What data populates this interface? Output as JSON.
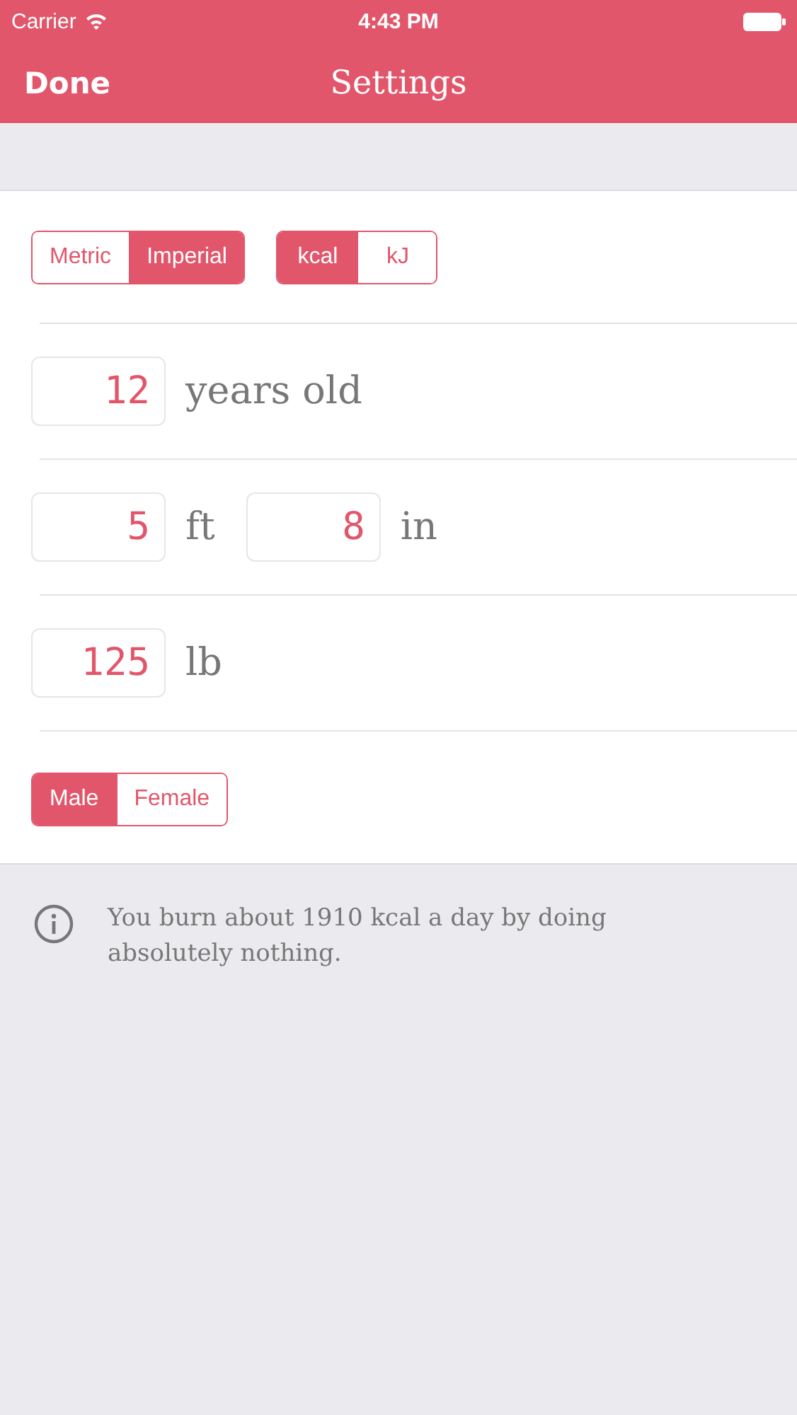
{
  "status_bar": {
    "carrier": "Carrier",
    "time": "4:43 PM"
  },
  "nav_bar": {
    "left_button": "Done",
    "title": "Settings"
  },
  "rows": [
    {
      "kind": "segments",
      "groups": [
        {
          "options": [
            {
              "label": "Metric",
              "selected": false
            },
            {
              "label": "Imperial",
              "selected": true
            }
          ]
        },
        {
          "options": [
            {
              "label": "kcal",
              "selected": true
            },
            {
              "label": "kJ",
              "selected": false
            }
          ]
        }
      ]
    },
    {
      "kind": "fields",
      "items": [
        {
          "value": "12",
          "unit": "years old"
        }
      ]
    },
    {
      "kind": "fields",
      "items": [
        {
          "value": "5",
          "unit": "ft"
        },
        {
          "value": "8",
          "unit": "in"
        }
      ]
    },
    {
      "kind": "fields",
      "items": [
        {
          "value": "125",
          "unit": "lb"
        }
      ]
    },
    {
      "kind": "segments",
      "groups": [
        {
          "options": [
            {
              "label": "Male",
              "selected": true
            },
            {
              "label": "Female",
              "selected": false
            }
          ]
        }
      ]
    }
  ],
  "info": {
    "text": "You burn about 1910 kcal a day by doing absolutely nothing."
  }
}
